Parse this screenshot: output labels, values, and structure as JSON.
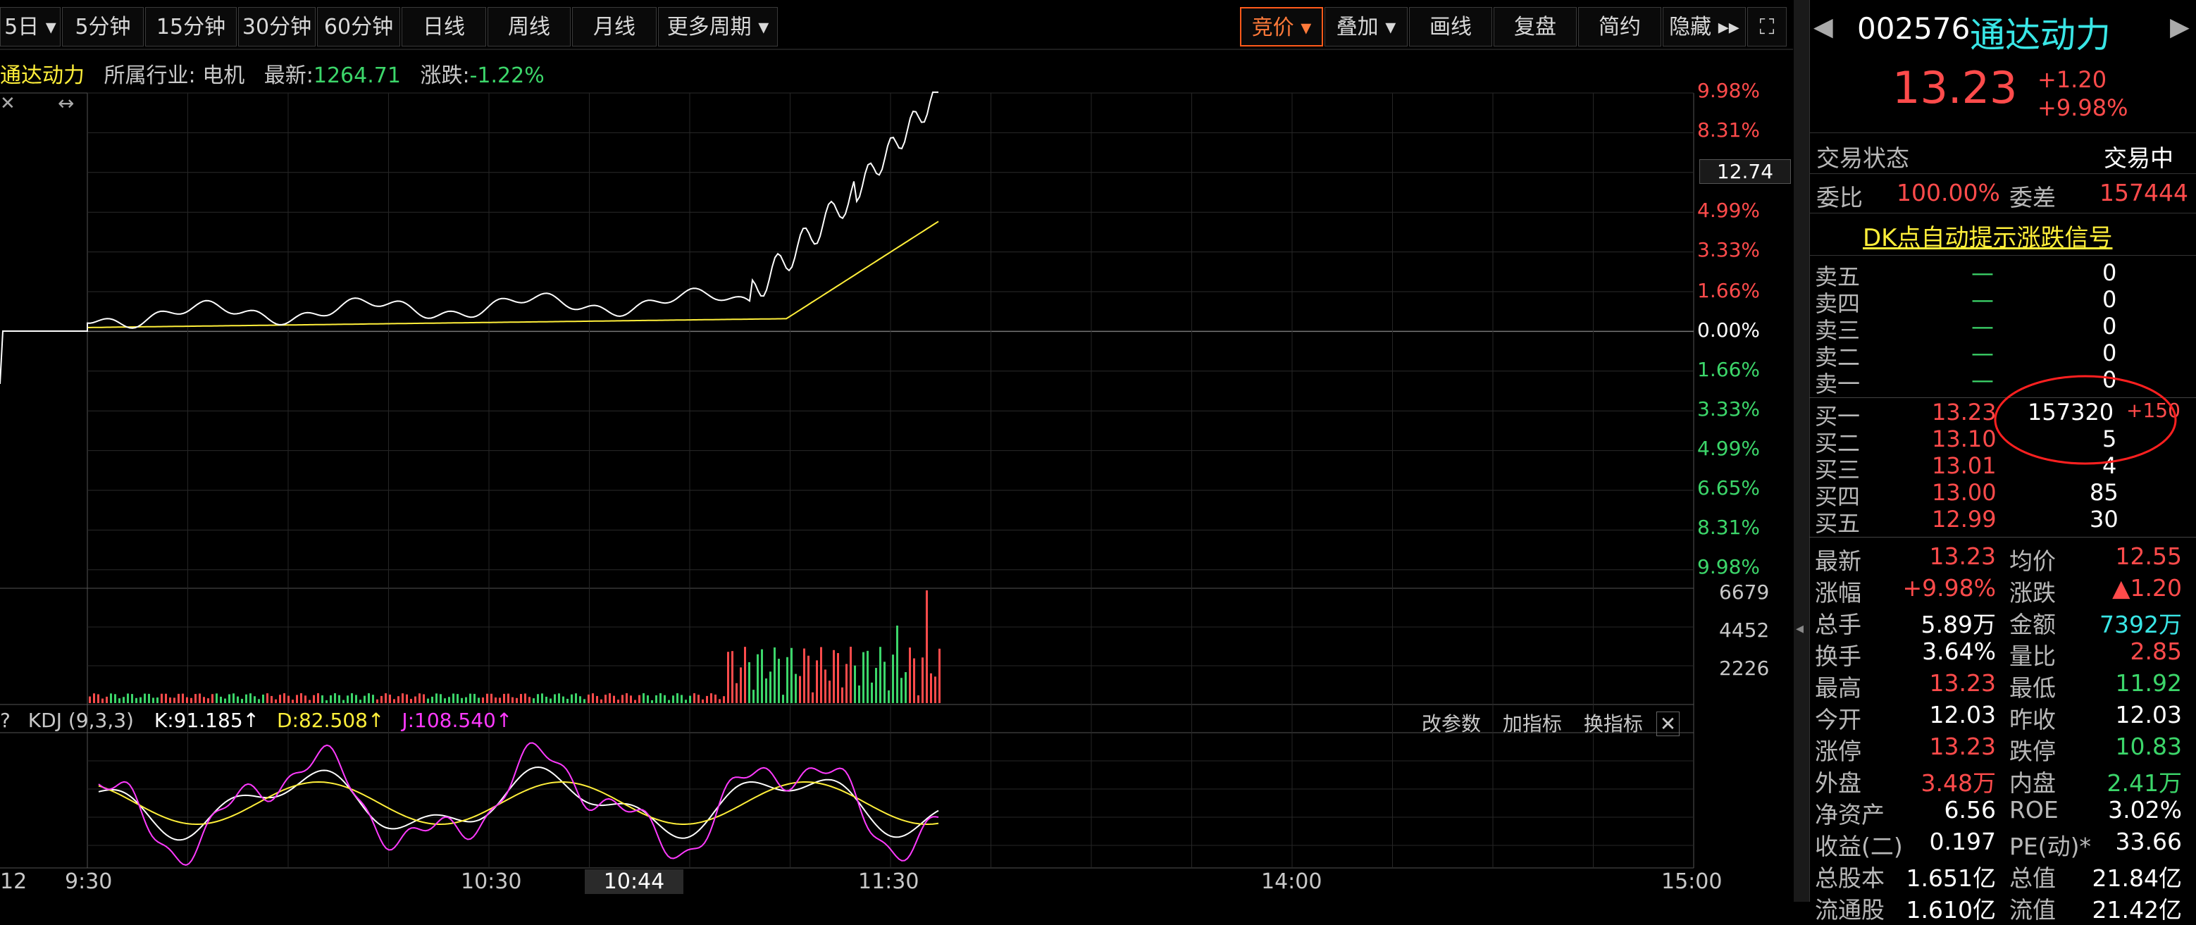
{
  "toolbar": {
    "periods": [
      "5日",
      "5分钟",
      "15分钟",
      "30分钟",
      "60分钟",
      "日线",
      "周线",
      "月线",
      "更多周期"
    ],
    "right_buttons": [
      "竞价",
      "叠加",
      "画线",
      "复盘",
      "简约",
      "隐藏"
    ]
  },
  "info": {
    "name": "通达动力",
    "industry_label": "所属行业:",
    "industry": "电机",
    "latest_label": "最新:",
    "latest": "1264.71",
    "change_label": "涨跌:",
    "change": "-1.22%"
  },
  "price_axis": [
    "9.98%",
    "8.31%",
    "12.74",
    "4.99%",
    "3.33%",
    "1.66%",
    "0.00%",
    "1.66%",
    "3.33%",
    "4.99%",
    "6.65%",
    "8.31%",
    "9.98%"
  ],
  "volume_axis": [
    "6679",
    "4452",
    "2226"
  ],
  "kdj": {
    "question": "?",
    "name": "KDJ (9,3,3)",
    "k": "K:91.185↑",
    "d": "D:82.508↑",
    "j": "J:108.540↑",
    "actions": [
      "改参数",
      "加指标",
      "换指标"
    ]
  },
  "time_axis": [
    "12",
    "9:30",
    "10:30",
    "10:44",
    "11:30",
    "14:00",
    "15:00"
  ],
  "quote": {
    "code": "002576",
    "name": "通达动力",
    "price": "13.23",
    "change": "+1.20",
    "pct": "+9.98%",
    "status_label": "交易状态",
    "status": "交易中",
    "wb_label": "委比",
    "wb": "100.00%",
    "wc_label": "委差",
    "wc": "157444",
    "signal_link": "DK点自动提示涨跌信号"
  },
  "sells": [
    {
      "label": "卖五",
      "price": "—",
      "vol": "0"
    },
    {
      "label": "卖四",
      "price": "—",
      "vol": "0"
    },
    {
      "label": "卖三",
      "price": "—",
      "vol": "0"
    },
    {
      "label": "卖二",
      "price": "—",
      "vol": "0"
    },
    {
      "label": "卖一",
      "price": "—",
      "vol": "0"
    }
  ],
  "buys": [
    {
      "label": "买一",
      "price": "13.23",
      "vol": "157320",
      "extra": "+150"
    },
    {
      "label": "买二",
      "price": "13.10",
      "vol": "5",
      "extra": ""
    },
    {
      "label": "买三",
      "price": "13.01",
      "vol": "4",
      "extra": ""
    },
    {
      "label": "买四",
      "price": "13.00",
      "vol": "85",
      "extra": ""
    },
    {
      "label": "买五",
      "price": "12.99",
      "vol": "30",
      "extra": ""
    }
  ],
  "stats": [
    {
      "l1": "最新",
      "v1": "13.23",
      "c1": "red",
      "l2": "均价",
      "v2": "12.55",
      "c2": "red"
    },
    {
      "l1": "涨幅",
      "v1": "+9.98%",
      "c1": "red",
      "l2": "涨跌",
      "v2": "▲1.20",
      "c2": "red"
    },
    {
      "l1": "总手",
      "v1": "5.89万",
      "c1": "white",
      "l2": "金额",
      "v2": "7392万",
      "c2": "cyan"
    },
    {
      "l1": "换手",
      "v1": "3.64%",
      "c1": "white",
      "l2": "量比",
      "v2": "2.85",
      "c2": "red"
    },
    {
      "l1": "最高",
      "v1": "13.23",
      "c1": "red",
      "l2": "最低",
      "v2": "11.92",
      "c2": "green"
    },
    {
      "l1": "今开",
      "v1": "12.03",
      "c1": "white",
      "l2": "昨收",
      "v2": "12.03",
      "c2": "white"
    },
    {
      "l1": "涨停",
      "v1": "13.23",
      "c1": "red",
      "l2": "跌停",
      "v2": "10.83",
      "c2": "green"
    },
    {
      "l1": "外盘",
      "v1": "3.48万",
      "c1": "red",
      "l2": "内盘",
      "v2": "2.41万",
      "c2": "green"
    },
    {
      "l1": "净资产",
      "v1": "6.56",
      "c1": "white",
      "l2": "ROE",
      "v2": "3.02%",
      "c2": "white"
    },
    {
      "l1": "收益(二)",
      "v1": "0.197",
      "c1": "white",
      "l2": "PE(动)*",
      "v2": "33.66",
      "c2": "white"
    },
    {
      "l1": "总股本",
      "v1": "1.651亿",
      "c1": "white",
      "l2": "总值",
      "v2": "21.84亿",
      "c2": "white"
    },
    {
      "l1": "流通股",
      "v1": "1.610亿",
      "c1": "white",
      "l2": "流值",
      "v2": "21.42亿",
      "c2": "white"
    }
  ],
  "colors": {
    "up": "#ff4b4b",
    "down": "#3cd66a",
    "avg": "#ffef3a",
    "price": "#ffffff",
    "accent": "#ff5a1a",
    "link": "#ffef3a"
  }
}
